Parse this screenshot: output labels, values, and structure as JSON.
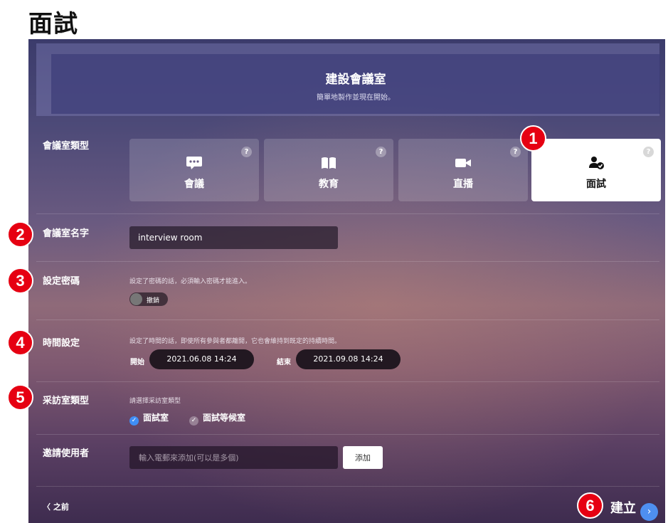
{
  "page_title": "面試",
  "banner": {
    "title": "建設會議室",
    "subtitle": "簡單地製作並現在開始。"
  },
  "room_type": {
    "label": "會議室類型",
    "help": "?",
    "options": [
      {
        "label": "會議",
        "icon": "chat-bubble-icon"
      },
      {
        "label": "教育",
        "icon": "open-book-icon"
      },
      {
        "label": "直播",
        "icon": "video-camera-icon"
      },
      {
        "label": "面試",
        "icon": "user-check-icon",
        "selected": true
      }
    ]
  },
  "room_name": {
    "label": "會議室名字",
    "value": "interview room"
  },
  "password": {
    "label": "設定密碼",
    "hint": "設定了密碼的話，必須輸入密碼才能進入。",
    "toggle_label": "撤銷"
  },
  "time": {
    "label": "時間設定",
    "hint": "設定了時間的話，即使所有參與者都離開，它也會維持到既定的持續時間。",
    "start_label": "開始",
    "start_value": "2021.06.08 14:24",
    "end_label": "結束",
    "end_value": "2021.09.08 14:24"
  },
  "interview_room": {
    "label": "采訪室類型",
    "hint": "請選擇采訪室類型",
    "options": [
      {
        "label": "面試室",
        "checked": true
      },
      {
        "label": "面試等候室",
        "checked": false
      }
    ]
  },
  "invite": {
    "label": "邀請使用者",
    "placeholder": "輸入電郵來添加(可以是多個)",
    "add_label": "添加"
  },
  "footer": {
    "prev_label": "之前",
    "create_label": "建立"
  },
  "badges": [
    "1",
    "2",
    "3",
    "4",
    "5",
    "6"
  ],
  "colors": {
    "accent": "#3f8ef5",
    "badge": "#e60012"
  }
}
